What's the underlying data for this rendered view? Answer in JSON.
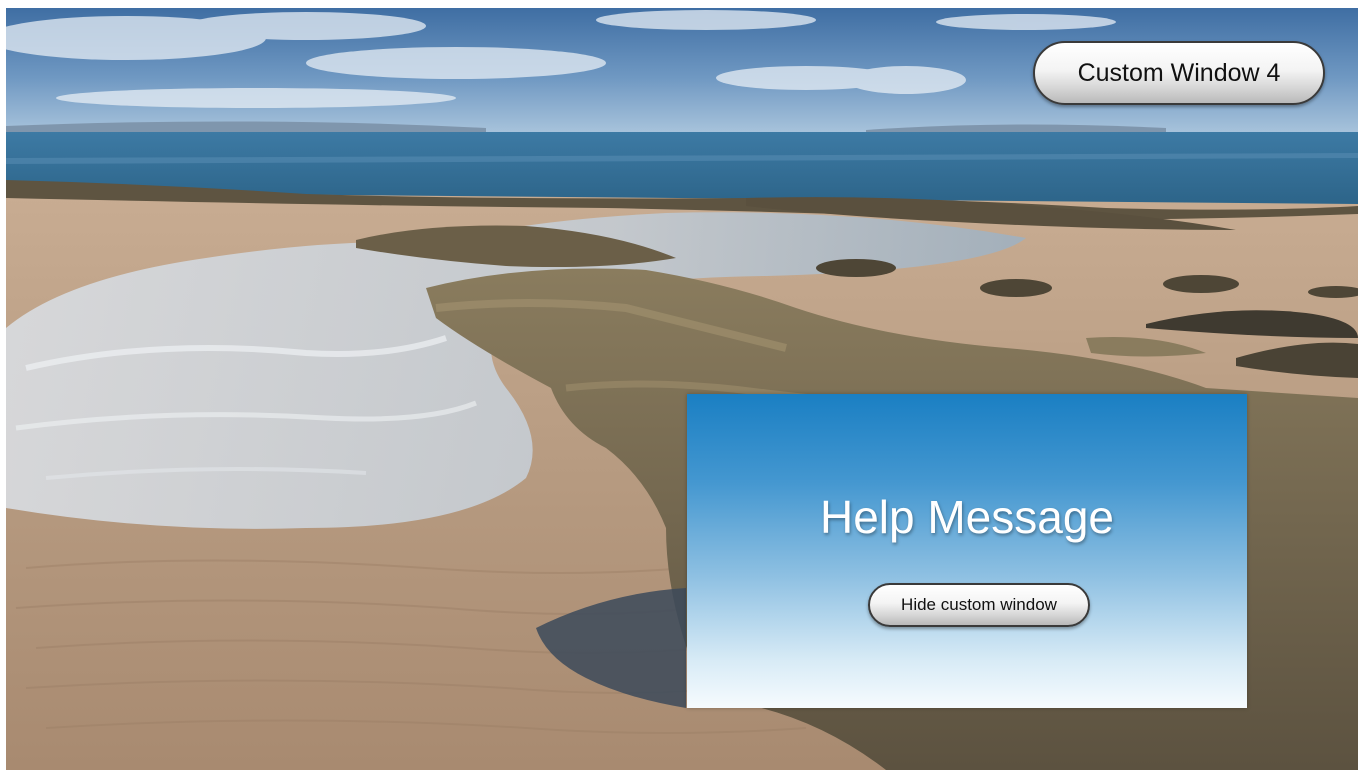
{
  "background": {
    "scene": "coastal-beach-photo",
    "colors": {
      "sky_top": "#3f6ea3",
      "sky_bottom": "#a9c4dc",
      "sea": "#2f6a93",
      "sand": "#b79a82",
      "rock": "#6e6248"
    }
  },
  "top_button": {
    "label": "Custom Window 4"
  },
  "help_window": {
    "title": "Help Message",
    "hide_button_label": "Hide custom window",
    "gradient_top": "#1a7fc3",
    "gradient_bottom": "#f6fbfe"
  }
}
